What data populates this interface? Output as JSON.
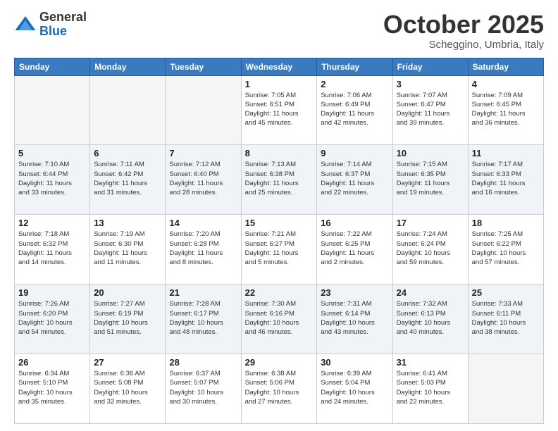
{
  "logo": {
    "general": "General",
    "blue": "Blue"
  },
  "header": {
    "month": "October 2025",
    "location": "Scheggino, Umbria, Italy"
  },
  "weekdays": [
    "Sunday",
    "Monday",
    "Tuesday",
    "Wednesday",
    "Thursday",
    "Friday",
    "Saturday"
  ],
  "weeks": [
    [
      {
        "day": "",
        "info": ""
      },
      {
        "day": "",
        "info": ""
      },
      {
        "day": "",
        "info": ""
      },
      {
        "day": "1",
        "info": "Sunrise: 7:05 AM\nSunset: 6:51 PM\nDaylight: 11 hours\nand 45 minutes."
      },
      {
        "day": "2",
        "info": "Sunrise: 7:06 AM\nSunset: 6:49 PM\nDaylight: 11 hours\nand 42 minutes."
      },
      {
        "day": "3",
        "info": "Sunrise: 7:07 AM\nSunset: 6:47 PM\nDaylight: 11 hours\nand 39 minutes."
      },
      {
        "day": "4",
        "info": "Sunrise: 7:09 AM\nSunset: 6:45 PM\nDaylight: 11 hours\nand 36 minutes."
      }
    ],
    [
      {
        "day": "5",
        "info": "Sunrise: 7:10 AM\nSunset: 6:44 PM\nDaylight: 11 hours\nand 33 minutes."
      },
      {
        "day": "6",
        "info": "Sunrise: 7:11 AM\nSunset: 6:42 PM\nDaylight: 11 hours\nand 31 minutes."
      },
      {
        "day": "7",
        "info": "Sunrise: 7:12 AM\nSunset: 6:40 PM\nDaylight: 11 hours\nand 28 minutes."
      },
      {
        "day": "8",
        "info": "Sunrise: 7:13 AM\nSunset: 6:38 PM\nDaylight: 11 hours\nand 25 minutes."
      },
      {
        "day": "9",
        "info": "Sunrise: 7:14 AM\nSunset: 6:37 PM\nDaylight: 11 hours\nand 22 minutes."
      },
      {
        "day": "10",
        "info": "Sunrise: 7:15 AM\nSunset: 6:35 PM\nDaylight: 11 hours\nand 19 minutes."
      },
      {
        "day": "11",
        "info": "Sunrise: 7:17 AM\nSunset: 6:33 PM\nDaylight: 11 hours\nand 16 minutes."
      }
    ],
    [
      {
        "day": "12",
        "info": "Sunrise: 7:18 AM\nSunset: 6:32 PM\nDaylight: 11 hours\nand 14 minutes."
      },
      {
        "day": "13",
        "info": "Sunrise: 7:19 AM\nSunset: 6:30 PM\nDaylight: 11 hours\nand 11 minutes."
      },
      {
        "day": "14",
        "info": "Sunrise: 7:20 AM\nSunset: 6:28 PM\nDaylight: 11 hours\nand 8 minutes."
      },
      {
        "day": "15",
        "info": "Sunrise: 7:21 AM\nSunset: 6:27 PM\nDaylight: 11 hours\nand 5 minutes."
      },
      {
        "day": "16",
        "info": "Sunrise: 7:22 AM\nSunset: 6:25 PM\nDaylight: 11 hours\nand 2 minutes."
      },
      {
        "day": "17",
        "info": "Sunrise: 7:24 AM\nSunset: 6:24 PM\nDaylight: 10 hours\nand 59 minutes."
      },
      {
        "day": "18",
        "info": "Sunrise: 7:25 AM\nSunset: 6:22 PM\nDaylight: 10 hours\nand 57 minutes."
      }
    ],
    [
      {
        "day": "19",
        "info": "Sunrise: 7:26 AM\nSunset: 6:20 PM\nDaylight: 10 hours\nand 54 minutes."
      },
      {
        "day": "20",
        "info": "Sunrise: 7:27 AM\nSunset: 6:19 PM\nDaylight: 10 hours\nand 51 minutes."
      },
      {
        "day": "21",
        "info": "Sunrise: 7:28 AM\nSunset: 6:17 PM\nDaylight: 10 hours\nand 48 minutes."
      },
      {
        "day": "22",
        "info": "Sunrise: 7:30 AM\nSunset: 6:16 PM\nDaylight: 10 hours\nand 46 minutes."
      },
      {
        "day": "23",
        "info": "Sunrise: 7:31 AM\nSunset: 6:14 PM\nDaylight: 10 hours\nand 43 minutes."
      },
      {
        "day": "24",
        "info": "Sunrise: 7:32 AM\nSunset: 6:13 PM\nDaylight: 10 hours\nand 40 minutes."
      },
      {
        "day": "25",
        "info": "Sunrise: 7:33 AM\nSunset: 6:11 PM\nDaylight: 10 hours\nand 38 minutes."
      }
    ],
    [
      {
        "day": "26",
        "info": "Sunrise: 6:34 AM\nSunset: 5:10 PM\nDaylight: 10 hours\nand 35 minutes."
      },
      {
        "day": "27",
        "info": "Sunrise: 6:36 AM\nSunset: 5:08 PM\nDaylight: 10 hours\nand 32 minutes."
      },
      {
        "day": "28",
        "info": "Sunrise: 6:37 AM\nSunset: 5:07 PM\nDaylight: 10 hours\nand 30 minutes."
      },
      {
        "day": "29",
        "info": "Sunrise: 6:38 AM\nSunset: 5:06 PM\nDaylight: 10 hours\nand 27 minutes."
      },
      {
        "day": "30",
        "info": "Sunrise: 6:39 AM\nSunset: 5:04 PM\nDaylight: 10 hours\nand 24 minutes."
      },
      {
        "day": "31",
        "info": "Sunrise: 6:41 AM\nSunset: 5:03 PM\nDaylight: 10 hours\nand 22 minutes."
      },
      {
        "day": "",
        "info": ""
      }
    ]
  ]
}
